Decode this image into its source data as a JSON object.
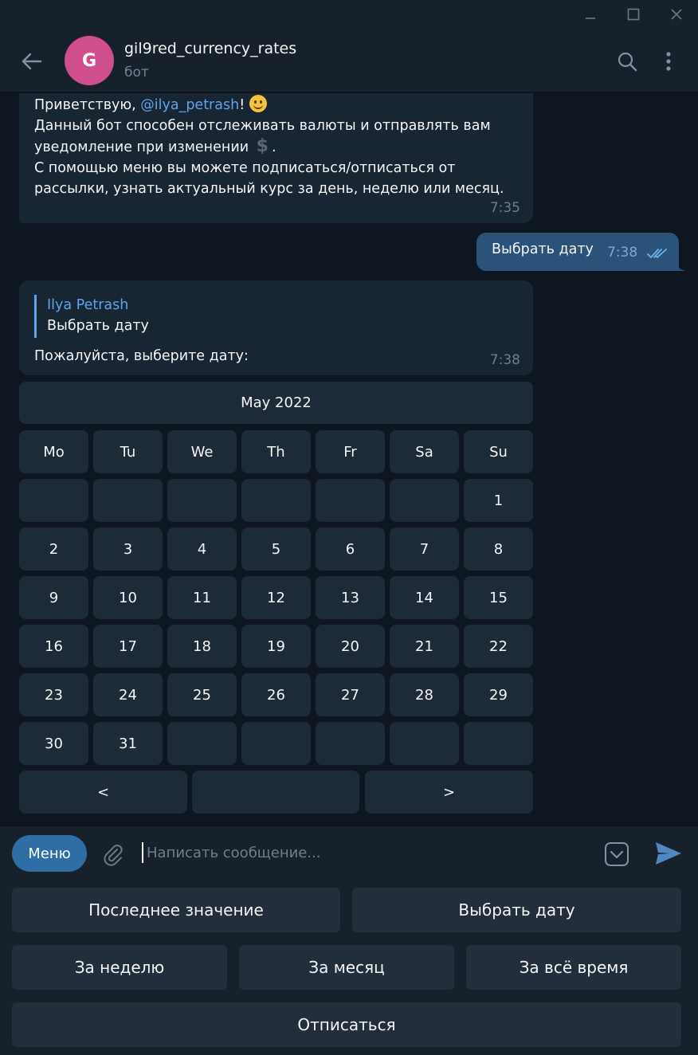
{
  "window": {
    "controls": [
      "minimize-icon",
      "maximize-icon",
      "close-icon"
    ]
  },
  "header": {
    "avatar_letter": "G",
    "avatar_color": "#cf4f8e",
    "title": "gil9red_currency_rates",
    "subtitle": "бот",
    "icons": [
      "back-arrow-icon",
      "search-icon",
      "more-vertical-icon"
    ]
  },
  "messages": {
    "welcome": {
      "greeting_prefix": "Приветствую, ",
      "mention": "@ilya_petrash",
      "greeting_suffix": "!",
      "line2_prefix": "Данный бот способен отслеживать валюты и отправлять вам уведомление при изменении",
      "line2_suffix": ".",
      "line3": "С помощью меню вы можете подписаться/отписаться от рассылки, узнать актуальный курс за день, неделю или месяц.",
      "time": "7:35"
    },
    "outgoing": {
      "text": "Выбрать дату",
      "time": "7:38",
      "status": "read"
    },
    "reply": {
      "quoted_author": "Ilya Petrash",
      "quoted_text": "Выбрать дату",
      "text": "Пожалуйста, выберите дату:",
      "time": "7:38"
    }
  },
  "calendar": {
    "month_label": "May 2022",
    "weekdays": [
      "Mo",
      "Tu",
      "We",
      "Th",
      "Fr",
      "Sa",
      "Su"
    ],
    "weeks": [
      [
        "",
        "",
        "",
        "",
        "",
        "",
        "1"
      ],
      [
        "2",
        "3",
        "4",
        "5",
        "6",
        "7",
        "8"
      ],
      [
        "9",
        "10",
        "11",
        "12",
        "13",
        "14",
        "15"
      ],
      [
        "16",
        "17",
        "18",
        "19",
        "20",
        "21",
        "22"
      ],
      [
        "23",
        "24",
        "25",
        "26",
        "27",
        "28",
        "29"
      ],
      [
        "30",
        "31",
        "",
        "",
        "",
        "",
        ""
      ]
    ],
    "nav": [
      "<",
      "",
      ">"
    ]
  },
  "composer": {
    "menu_label": "Меню",
    "placeholder": "Написать сообщение..."
  },
  "reply_keyboard": {
    "rows": [
      [
        "Последнее значение",
        "Выбрать дату"
      ],
      [
        "За неделю",
        "За месяц",
        "За всё время"
      ],
      [
        "Отписаться"
      ]
    ]
  },
  "colors": {
    "background": "#0e1621",
    "panel": "#17212b",
    "incoming_bubble": "#182533",
    "outgoing_bubble": "#2b5278",
    "accent": "#5ea5e8",
    "menu_button": "#2f6ea5"
  }
}
